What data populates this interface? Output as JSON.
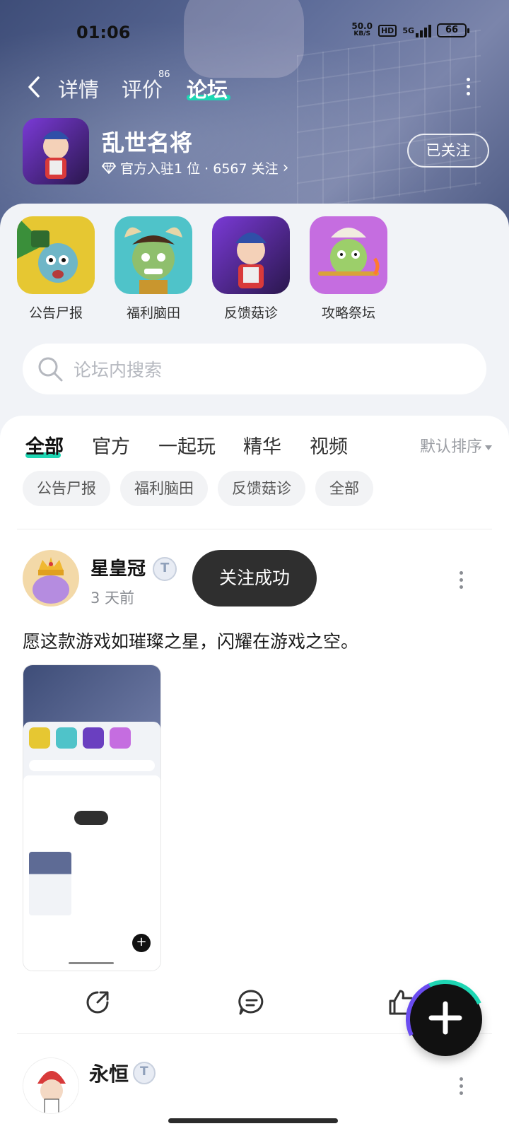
{
  "status": {
    "time": "01:06",
    "netspeed_value": "50.0",
    "netspeed_unit": "KB/S",
    "hd": "HD",
    "network": "5G",
    "battery": "66"
  },
  "nav": {
    "tabs": [
      {
        "label": "详情"
      },
      {
        "label": "评价",
        "count": "86"
      },
      {
        "label": "论坛"
      }
    ]
  },
  "game": {
    "name": "乱世名将",
    "meta": "官方入驻1 位 · 6567 关注",
    "follow_label": "已关注"
  },
  "boards": [
    {
      "label": "公告尸报",
      "icon": "zombie-warrior-icon"
    },
    {
      "label": "福利脑田",
      "icon": "horned-zombie-icon"
    },
    {
      "label": "反馈菇诊",
      "icon": "general-hero-icon"
    },
    {
      "label": "攻略祭坛",
      "icon": "green-zombie-icon"
    }
  ],
  "search": {
    "placeholder": "论坛内搜索"
  },
  "feed_tabs": [
    {
      "label": "全部"
    },
    {
      "label": "官方"
    },
    {
      "label": "一起玩"
    },
    {
      "label": "精华"
    },
    {
      "label": "视频"
    }
  ],
  "sort_label": "默认排序",
  "chips": [
    "公告尸报",
    "福利脑田",
    "反馈菇诊",
    "全部"
  ],
  "post": {
    "username": "星皇冠",
    "time": "3 天前",
    "text": "愿这款游戏如璀璨之星，闪耀在游戏之空。"
  },
  "toast": "关注成功",
  "post2": {
    "username": "永恒"
  },
  "colors": {
    "accent": "#1ed6b3",
    "hero": "#4d5a83",
    "toast": "#2f2f2f"
  }
}
